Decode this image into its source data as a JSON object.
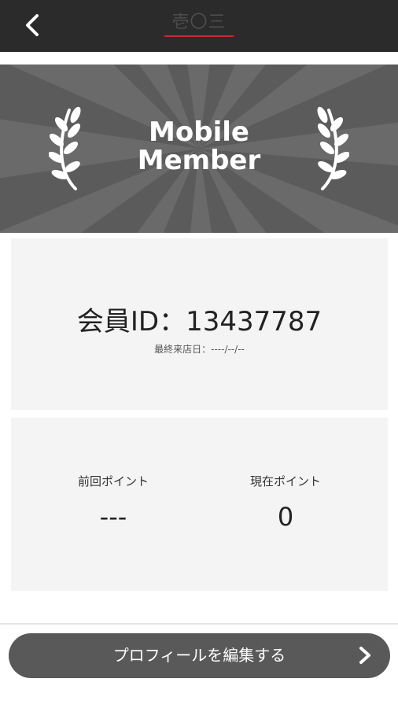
{
  "header": {
    "logo_text": "壱〇三",
    "back_icon": "chevron-left-icon"
  },
  "banner": {
    "title_line1": "Mobile",
    "title_line2": "Member",
    "decoration_icon": "laurel-icon"
  },
  "member_card": {
    "id_label": "会員ID：13437787",
    "last_visit_label": "最終来店日：----/--/--"
  },
  "points": {
    "previous_label": "前回ポイント",
    "previous_value": "---",
    "current_label": "現在ポイント",
    "current_value": "0"
  },
  "edit_profile_button": {
    "label": "プロフィールを編集する",
    "icon": "chevron-right-icon"
  },
  "colors": {
    "header_bg": "#2b2b2b",
    "banner_bg": "#5b5b5b",
    "card_bg": "#f4f4f4",
    "button_bg": "#595959",
    "logo_accent": "#c62b35"
  }
}
